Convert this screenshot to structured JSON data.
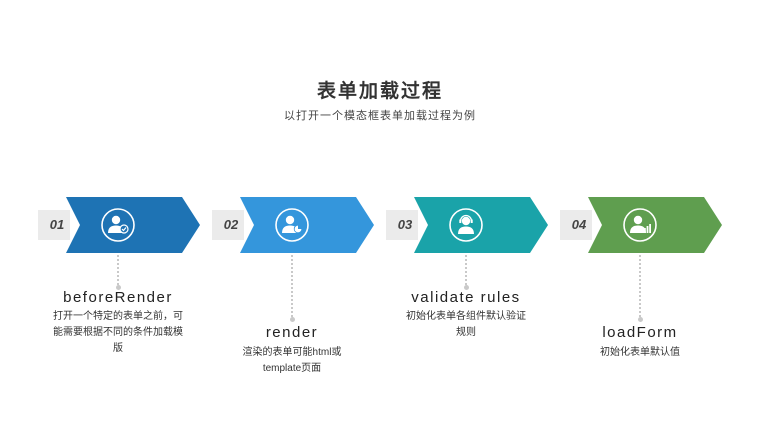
{
  "header": {
    "title": "表单加载过程",
    "subtitle": "以打开一个模态框表单加载过程为例"
  },
  "steps": [
    {
      "number": "01",
      "color": "#1e73b4",
      "name": "beforeRender",
      "description": "打开一个特定的表单之前，可能需要根据不同的条件加载模版",
      "icon": "user-check-icon"
    },
    {
      "number": "02",
      "color": "#3496dc",
      "name": "render",
      "description": "渲染的表单可能html或template页面",
      "icon": "user-chart-icon"
    },
    {
      "number": "03",
      "color": "#1aa3a9",
      "name": "validate rules",
      "description": "初始化表单各组件默认验证规则",
      "icon": "headset-user-icon"
    },
    {
      "number": "04",
      "color": "#5f9e4f",
      "name": "loadForm",
      "description": "初始化表单默认值",
      "icon": "user-bar-chart-icon"
    }
  ]
}
